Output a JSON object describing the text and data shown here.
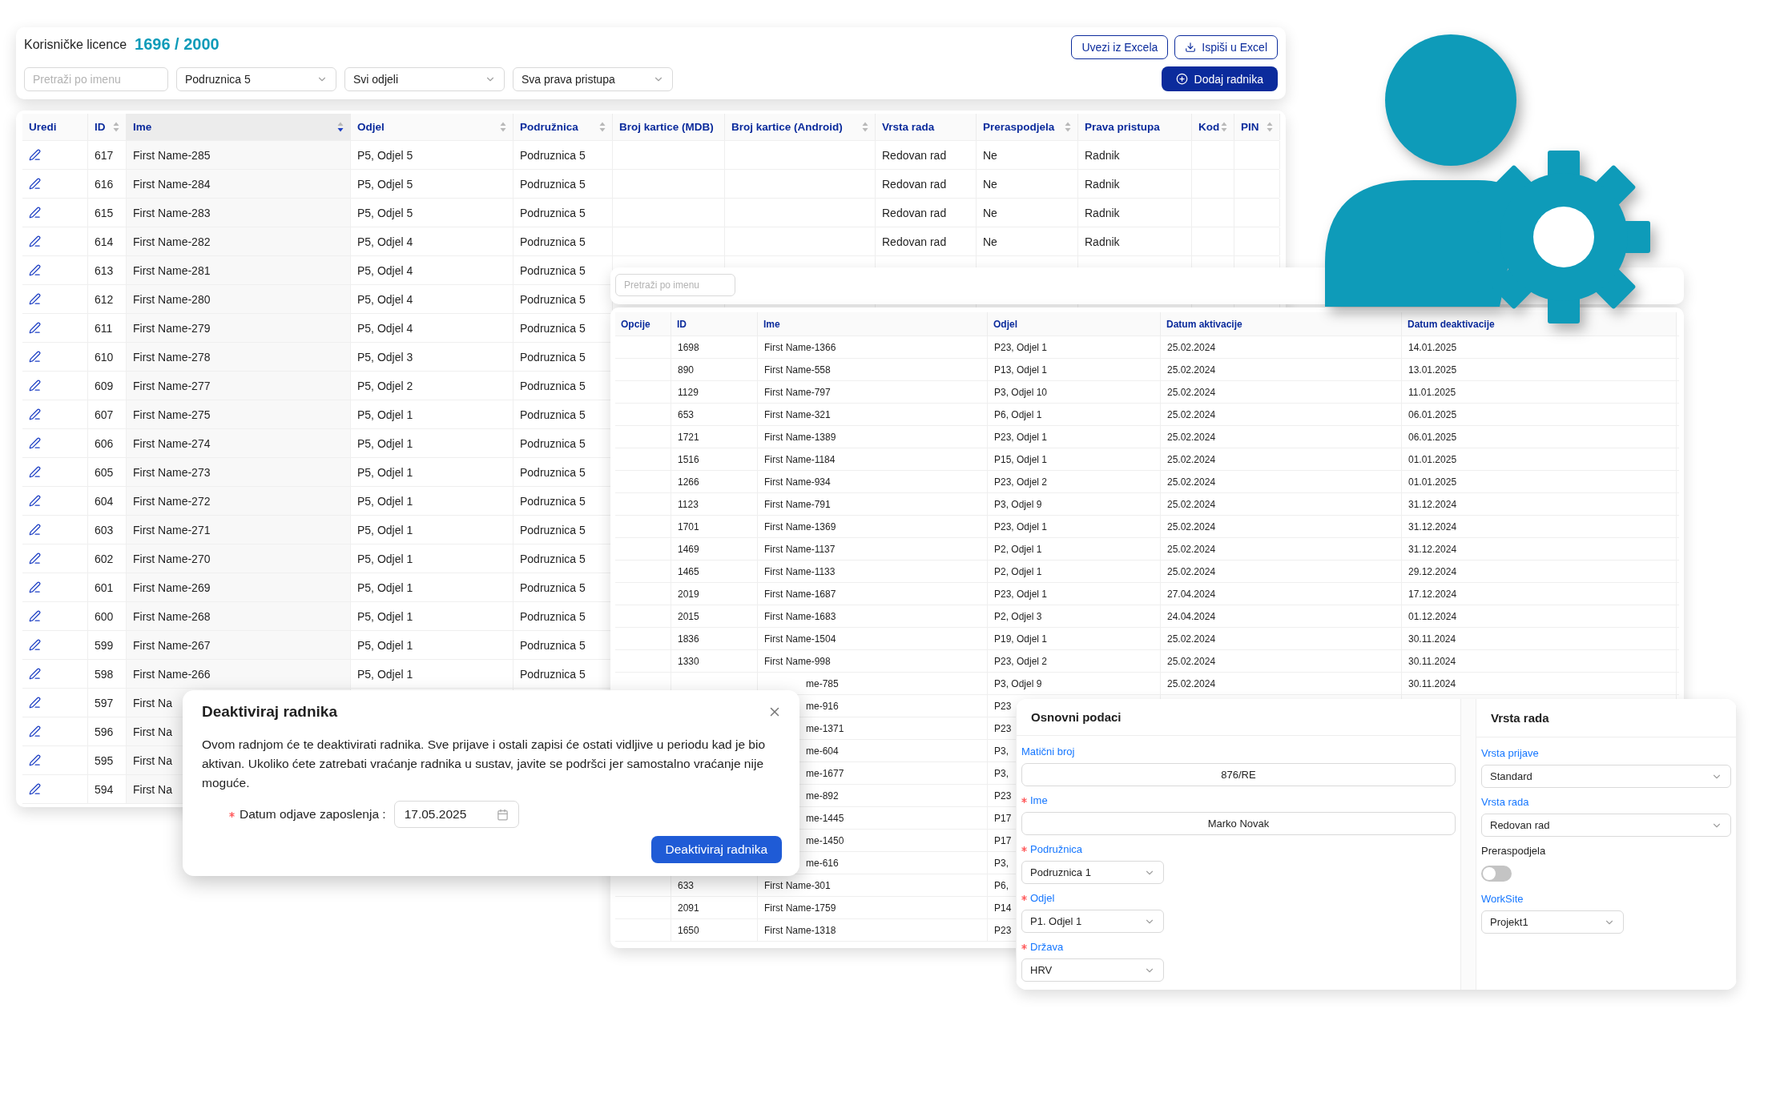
{
  "licences": {
    "label": "Korisničke licence",
    "count": "1696 / 2000"
  },
  "toolbar": {
    "search": {
      "placeholder": "Pretraži po imenu"
    },
    "filters": [
      "Podruznica 5",
      "Svi odjeli",
      "Sva prava pristupa"
    ],
    "import_button": "Uvezi iz Excela",
    "export_button": "Ispiši u Excel",
    "add_button": "Dodaj radnika"
  },
  "employees": {
    "columns": [
      {
        "label": "Uredi",
        "sortable": false,
        "sorted": false
      },
      {
        "label": "ID",
        "sortable": true,
        "sorted": false
      },
      {
        "label": "Ime",
        "sortable": true,
        "sorted": true
      },
      {
        "label": "Odjel",
        "sortable": true,
        "sorted": false
      },
      {
        "label": "Podružnica",
        "sortable": true,
        "sorted": false
      },
      {
        "label": "Broj kartice (MDB)",
        "sortable": false,
        "sorted": false
      },
      {
        "label": "Broj kartice (Android)",
        "sortable": true,
        "sorted": false
      },
      {
        "label": "Vrsta rada",
        "sortable": false,
        "sorted": false
      },
      {
        "label": "Preraspodjela",
        "sortable": true,
        "sorted": false
      },
      {
        "label": "Prava pristupa",
        "sortable": false,
        "sorted": false
      },
      {
        "label": "Kod",
        "sortable": true,
        "sorted": false
      },
      {
        "label": "PIN",
        "sortable": true,
        "sorted": false
      }
    ],
    "rows": [
      {
        "id": "617",
        "ime": "First Name-285",
        "odjel": "P5, Odjel 5",
        "podruznica": "Podruznica 5",
        "vrsta_rada": "Redovan rad",
        "preraspodjela": "Ne",
        "prava_pristupa": "Radnik"
      },
      {
        "id": "616",
        "ime": "First Name-284",
        "odjel": "P5, Odjel 5",
        "podruznica": "Podruznica 5",
        "vrsta_rada": "Redovan rad",
        "preraspodjela": "Ne",
        "prava_pristupa": "Radnik"
      },
      {
        "id": "615",
        "ime": "First Name-283",
        "odjel": "P5, Odjel 5",
        "podruznica": "Podruznica 5",
        "vrsta_rada": "Redovan rad",
        "preraspodjela": "Ne",
        "prava_pristupa": "Radnik"
      },
      {
        "id": "614",
        "ime": "First Name-282",
        "odjel": "P5, Odjel 4",
        "podruznica": "Podruznica 5",
        "vrsta_rada": "Redovan rad",
        "preraspodjela": "Ne",
        "prava_pristupa": "Radnik"
      },
      {
        "id": "613",
        "ime": "First Name-281",
        "odjel": "P5, Odjel 4",
        "podruznica": "Podruznica 5"
      },
      {
        "id": "612",
        "ime": "First Name-280",
        "odjel": "P5, Odjel 4",
        "podruznica": "Podruznica 5"
      },
      {
        "id": "611",
        "ime": "First Name-279",
        "odjel": "P5, Odjel 4",
        "podruznica": "Podruznica 5"
      },
      {
        "id": "610",
        "ime": "First Name-278",
        "odjel": "P5, Odjel 3",
        "podruznica": "Podruznica 5"
      },
      {
        "id": "609",
        "ime": "First Name-277",
        "odjel": "P5, Odjel 2",
        "podruznica": "Podruznica 5"
      },
      {
        "id": "607",
        "ime": "First Name-275",
        "odjel": "P5, Odjel 1",
        "podruznica": "Podruznica 5"
      },
      {
        "id": "606",
        "ime": "First Name-274",
        "odjel": "P5, Odjel 1",
        "podruznica": "Podruznica 5"
      },
      {
        "id": "605",
        "ime": "First Name-273",
        "odjel": "P5, Odjel 1",
        "podruznica": "Podruznica 5"
      },
      {
        "id": "604",
        "ime": "First Name-272",
        "odjel": "P5, Odjel 1",
        "podruznica": "Podruznica 5"
      },
      {
        "id": "603",
        "ime": "First Name-271",
        "odjel": "P5, Odjel 1",
        "podruznica": "Podruznica 5"
      },
      {
        "id": "602",
        "ime": "First Name-270",
        "odjel": "P5, Odjel 1",
        "podruznica": "Podruznica 5"
      },
      {
        "id": "601",
        "ime": "First Name-269",
        "odjel": "P5, Odjel 1",
        "podruznica": "Podruznica 5"
      },
      {
        "id": "600",
        "ime": "First Name-268",
        "odjel": "P5, Odjel 1",
        "podruznica": "Podruznica 5"
      },
      {
        "id": "599",
        "ime": "First Name-267",
        "odjel": "P5, Odjel 1",
        "podruznica": "Podruznica 5"
      },
      {
        "id": "598",
        "ime": "First Name-266",
        "odjel": "P5, Odjel 1",
        "podruznica": "Podruznica 5"
      },
      {
        "id": "597",
        "ime": "First Na"
      },
      {
        "id": "596",
        "ime": "First Na"
      },
      {
        "id": "595",
        "ime": "First Na"
      },
      {
        "id": "594",
        "ime": "First Na"
      }
    ]
  },
  "deactivated": {
    "search": {
      "placeholder": "Pretraži po imenu"
    },
    "columns": [
      "Opcije",
      "ID",
      "Ime",
      "Odjel",
      "Datum aktivacije",
      "Datum deaktivacije"
    ],
    "rows": [
      {
        "id": "1698",
        "ime": "First Name-1366",
        "odjel": "P23, Odjel 1",
        "aktivacija": "25.02.2024",
        "deaktivacija": "14.01.2025"
      },
      {
        "id": "890",
        "ime": "First Name-558",
        "odjel": "P13, Odjel 1",
        "aktivacija": "25.02.2024",
        "deaktivacija": "13.01.2025"
      },
      {
        "id": "1129",
        "ime": "First Name-797",
        "odjel": "P3, Odjel 10",
        "aktivacija": "25.02.2024",
        "deaktivacija": "11.01.2025"
      },
      {
        "id": "653",
        "ime": "First Name-321",
        "odjel": "P6, Odjel 1",
        "aktivacija": "25.02.2024",
        "deaktivacija": "06.01.2025"
      },
      {
        "id": "1721",
        "ime": "First Name-1389",
        "odjel": "P23, Odjel 1",
        "aktivacija": "25.02.2024",
        "deaktivacija": "06.01.2025"
      },
      {
        "id": "1516",
        "ime": "First Name-1184",
        "odjel": "P15, Odjel 1",
        "aktivacija": "25.02.2024",
        "deaktivacija": "01.01.2025"
      },
      {
        "id": "1266",
        "ime": "First Name-934",
        "odjel": "P23, Odjel 2",
        "aktivacija": "25.02.2024",
        "deaktivacija": "01.01.2025"
      },
      {
        "id": "1123",
        "ime": "First Name-791",
        "odjel": "P3, Odjel 9",
        "aktivacija": "25.02.2024",
        "deaktivacija": "31.12.2024"
      },
      {
        "id": "1701",
        "ime": "First Name-1369",
        "odjel": "P23, Odjel 1",
        "aktivacija": "25.02.2024",
        "deaktivacija": "31.12.2024"
      },
      {
        "id": "1469",
        "ime": "First Name-1137",
        "odjel": "P2, Odjel 1",
        "aktivacija": "25.02.2024",
        "deaktivacija": "31.12.2024"
      },
      {
        "id": "1465",
        "ime": "First Name-1133",
        "odjel": "P2, Odjel 1",
        "aktivacija": "25.02.2024",
        "deaktivacija": "29.12.2024"
      },
      {
        "id": "2019",
        "ime": "First Name-1687",
        "odjel": "P23, Odjel 1",
        "aktivacija": "27.04.2024",
        "deaktivacija": "17.12.2024"
      },
      {
        "id": "2015",
        "ime": "First Name-1683",
        "odjel": "P2, Odjel 3",
        "aktivacija": "24.04.2024",
        "deaktivacija": "01.12.2024"
      },
      {
        "id": "1836",
        "ime": "First Name-1504",
        "odjel": "P19, Odjel 1",
        "aktivacija": "25.02.2024",
        "deaktivacija": "30.11.2024"
      },
      {
        "id": "1330",
        "ime": "First Name-998",
        "odjel": "P23, Odjel 2",
        "aktivacija": "25.02.2024",
        "deaktivacija": "30.11.2024"
      },
      {
        "ime": "me-785",
        "odjel": "P3, Odjel 9",
        "aktivacija": "25.02.2024",
        "deaktivacija": "30.11.2024"
      },
      {
        "ime": "me-916",
        "odjel": "P23"
      },
      {
        "ime": "me-1371",
        "odjel": "P23"
      },
      {
        "ime": "me-604",
        "odjel": "P3,"
      },
      {
        "ime": "me-1677",
        "odjel": "P3,"
      },
      {
        "ime": "me-892",
        "odjel": "P23"
      },
      {
        "ime": "me-1445",
        "odjel": "P17"
      },
      {
        "ime": "me-1450",
        "odjel": "P17"
      },
      {
        "ime": "me-616",
        "odjel": "P3,"
      },
      {
        "id": "633",
        "ime": "First Name-301",
        "odjel": "P6,"
      },
      {
        "id": "2091",
        "ime": "First Name-1759",
        "odjel": "P14"
      },
      {
        "id": "1650",
        "ime": "First Name-1318",
        "odjel": "P23"
      }
    ]
  },
  "dialog": {
    "title": "Deaktiviraj radnika",
    "text": "Ovom radnjom će te deaktivirati radnika. Sve prijave i ostali zapisi će ostati vidljive u periodu kad je bio aktivan. Ukoliko ćete zatrebati vraćanje radnika u sustav, javite se podršci jer samostalno vraćanje nije moguće.",
    "date_field": {
      "label": "Datum odjave zaposlenja :",
      "required": true,
      "value": "17.05.2025"
    },
    "button": "Deaktiviraj radnika"
  },
  "form": {
    "basic": {
      "title": "Osnovni podaci",
      "fields": [
        {
          "kind": "input",
          "label": "Matični broj",
          "required": false,
          "value": "876/RE"
        },
        {
          "kind": "input",
          "label": "Ime",
          "required": true,
          "value": "Marko Novak"
        },
        {
          "kind": "short_select",
          "label": "Podružnica",
          "required": true,
          "value": "Podruznica 1"
        },
        {
          "kind": "short_select",
          "label": "Odjel",
          "required": true,
          "value": "P1. Odjel 1"
        },
        {
          "kind": "short_select",
          "label": "Država",
          "required": true,
          "value": "HRV"
        }
      ]
    },
    "work": {
      "title": "Vrsta rada",
      "fields": [
        {
          "kind": "select",
          "label": "Vrsta prijave",
          "required": false,
          "value": "Standard"
        },
        {
          "kind": "select",
          "label": "Vrsta rada",
          "required": false,
          "value": "Redovan rad"
        },
        {
          "kind": "toggle",
          "label": "Preraspodjela",
          "required": false,
          "on": false
        },
        {
          "kind": "short_select",
          "label": "WorkSite",
          "required": false,
          "value": "Projekt1"
        }
      ]
    }
  }
}
